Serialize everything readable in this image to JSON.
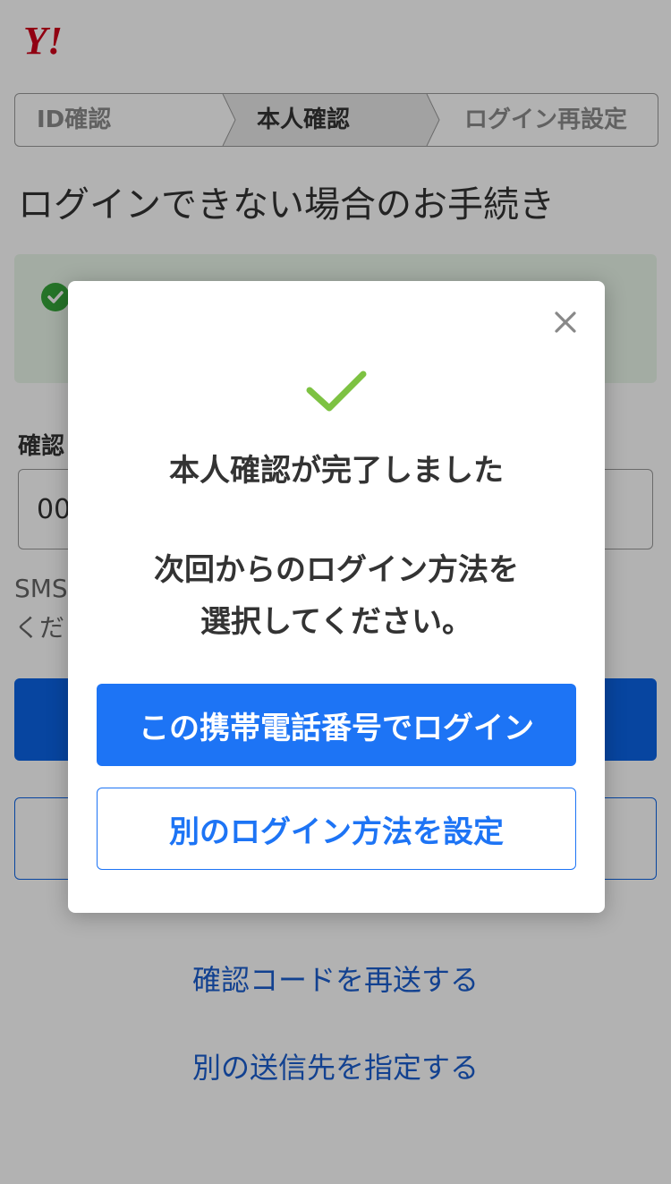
{
  "brand": {
    "logo_text": "Y!",
    "logo_color": "#d0021b"
  },
  "steps": [
    {
      "label": "ID確認",
      "state": "done"
    },
    {
      "label": "本人確認",
      "state": "current"
    },
    {
      "label": "ログイン再設定",
      "state": "upcoming"
    }
  ],
  "page_title": "ログインできない場合のお手続き",
  "notice": {
    "icon": "check-circle-icon",
    "text": ""
  },
  "code_field": {
    "label": "確認",
    "value": "00"
  },
  "sms_text": "SMS\nくださ",
  "background_buttons": {
    "primary_label": "",
    "secondary_label": ""
  },
  "links": {
    "resend": "確認コードを再送する",
    "other_destination": "別の送信先を指定する"
  },
  "modal": {
    "close_icon": "close-icon",
    "success_icon": "checkmark-icon",
    "heading": "本人確認が完了しました",
    "sub_line_1": "次回からのログイン方法を",
    "sub_line_2": "選択してください。",
    "primary_button": "この携帯電話番号でログイン",
    "secondary_button": "別のログイン方法を設定"
  },
  "colors": {
    "primary_blue": "#1d74f5",
    "success_green": "#7dc242",
    "overlay": "rgba(0,0,0,0.30)"
  }
}
